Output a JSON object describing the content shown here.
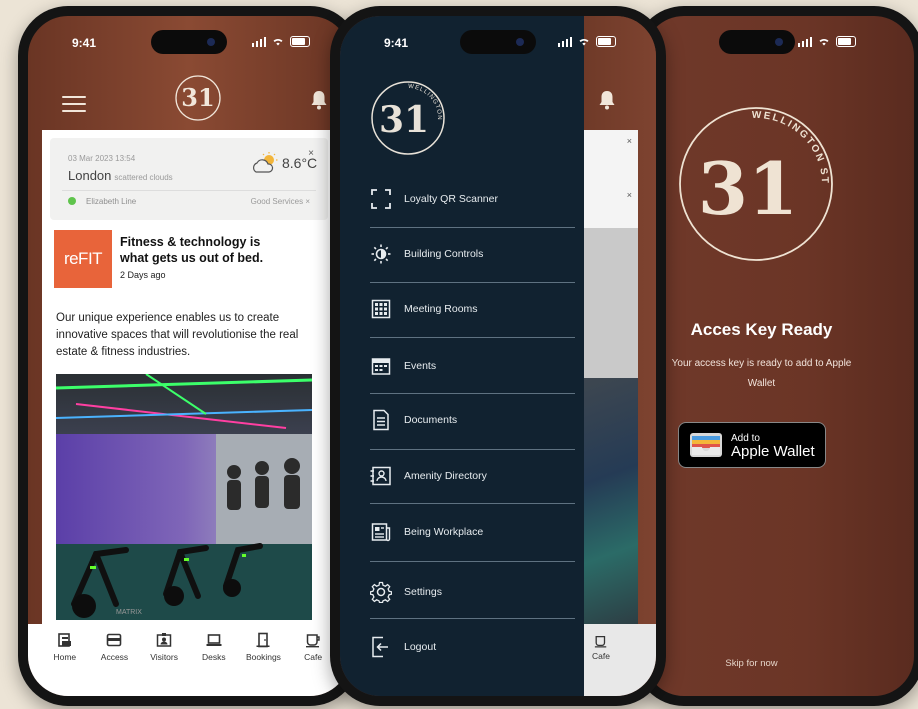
{
  "status": {
    "time": "9:41"
  },
  "brand": {
    "logo_number": "31",
    "logo_ring_text": "WELLINGTON STREET"
  },
  "home": {
    "weather": {
      "date": "03 Mar 2023 13:54",
      "city": "London",
      "description": "scattered clouds",
      "temperature": "8.6°C",
      "close": "×",
      "line_name": "Elizabeth Line",
      "line_status": "Good Services ×"
    },
    "article": {
      "thumb_text": "reFIT",
      "title": "Fitness & technology is what gets us out of bed.",
      "time": "2 Days ago",
      "body": "Our unique experience enables us to create innovative spaces that will revolutionise the real estate & fitness industries.",
      "image_brand": "MATRIX"
    },
    "tabs": [
      {
        "label": "Home",
        "icon": "home-icon"
      },
      {
        "label": "Access",
        "icon": "card-icon"
      },
      {
        "label": "Visitors",
        "icon": "visitor-icon"
      },
      {
        "label": "Desks",
        "icon": "laptop-icon"
      },
      {
        "label": "Bookings",
        "icon": "door-icon"
      },
      {
        "label": "Cafe",
        "icon": "cup-icon"
      }
    ]
  },
  "menu": {
    "items": [
      {
        "label": "Loyalty QR Scanner",
        "icon": "qr-scanner-icon"
      },
      {
        "label": "Building Controls",
        "icon": "sun-icon"
      },
      {
        "label": "Meeting Rooms",
        "icon": "grid-icon"
      },
      {
        "label": "Events",
        "icon": "calendar-icon"
      },
      {
        "label": "Documents",
        "icon": "document-icon"
      },
      {
        "label": "Amenity Directory",
        "icon": "directory-icon"
      },
      {
        "label": "Being Workplace",
        "icon": "news-icon"
      },
      {
        "label": "Settings",
        "icon": "gear-icon"
      },
      {
        "label": "Logout",
        "icon": "logout-icon"
      }
    ],
    "peek_tab_label": "Cafe",
    "peek_close": "×"
  },
  "access": {
    "title": "Acces Key Ready",
    "text": "Your access key is ready to add to Apple Wallet",
    "wallet_top": "Add to",
    "wallet_bottom": "Apple Wallet",
    "skip": "Skip for now"
  },
  "colors": {
    "brand_brown": "#7a4230",
    "drawer_navy": "#112230",
    "refit_orange": "#e8643a",
    "status_green": "#5fc44c"
  }
}
